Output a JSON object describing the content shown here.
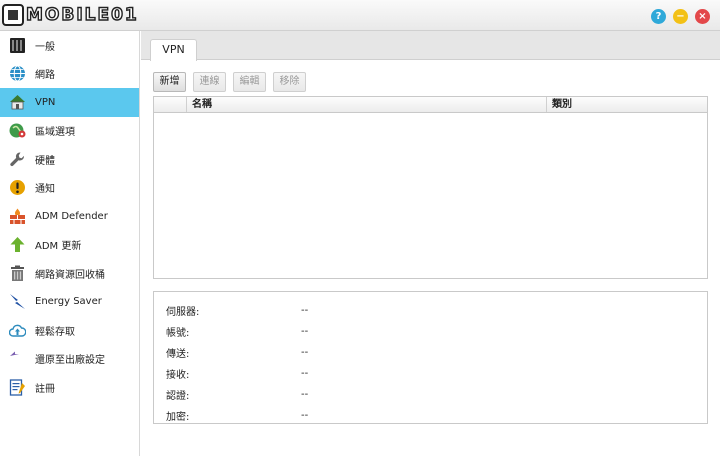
{
  "app": {
    "logo_text": "MOBILE01"
  },
  "window_buttons": {
    "help": "?",
    "minimize": "−",
    "close": "×"
  },
  "sidebar": {
    "items": [
      {
        "label": "一般",
        "icon": "server-icon"
      },
      {
        "label": "網路",
        "icon": "globe-icon"
      },
      {
        "label": "VPN",
        "icon": "vpn-house-icon",
        "active": true
      },
      {
        "label": "區域選項",
        "icon": "region-globe-pin-icon"
      },
      {
        "label": "硬體",
        "icon": "wrench-icon"
      },
      {
        "label": "通知",
        "icon": "alert-icon"
      },
      {
        "label": "ADM Defender",
        "icon": "firewall-icon"
      },
      {
        "label": "ADM 更新",
        "icon": "update-arrow-icon"
      },
      {
        "label": "網路資源回收桶",
        "icon": "recycle-bin-icon"
      },
      {
        "label": "Energy Saver",
        "icon": "energy-bolt-icon"
      },
      {
        "label": "輕鬆存取",
        "icon": "cloud-upload-icon"
      },
      {
        "label": "還原至出廠設定",
        "icon": "restore-icon"
      },
      {
        "label": "註冊",
        "icon": "register-icon"
      }
    ]
  },
  "main": {
    "tab": "VPN",
    "toolbar": {
      "add": "新增",
      "connect": "連線",
      "edit": "編輯",
      "remove": "移除"
    },
    "grid": {
      "col_name": "名稱",
      "col_type": "類別"
    },
    "info": [
      {
        "label": "伺服器:",
        "value": "--"
      },
      {
        "label": "帳號:",
        "value": "--"
      },
      {
        "label": "傳送:",
        "value": "--"
      },
      {
        "label": "接收:",
        "value": "--"
      },
      {
        "label": "認證:",
        "value": "--"
      },
      {
        "label": "加密:",
        "value": "--"
      }
    ]
  },
  "colors": {
    "active_item": "#5bc8ee",
    "help": "#2fa9d9",
    "minimize": "#f3c116",
    "close": "#e3484a"
  }
}
